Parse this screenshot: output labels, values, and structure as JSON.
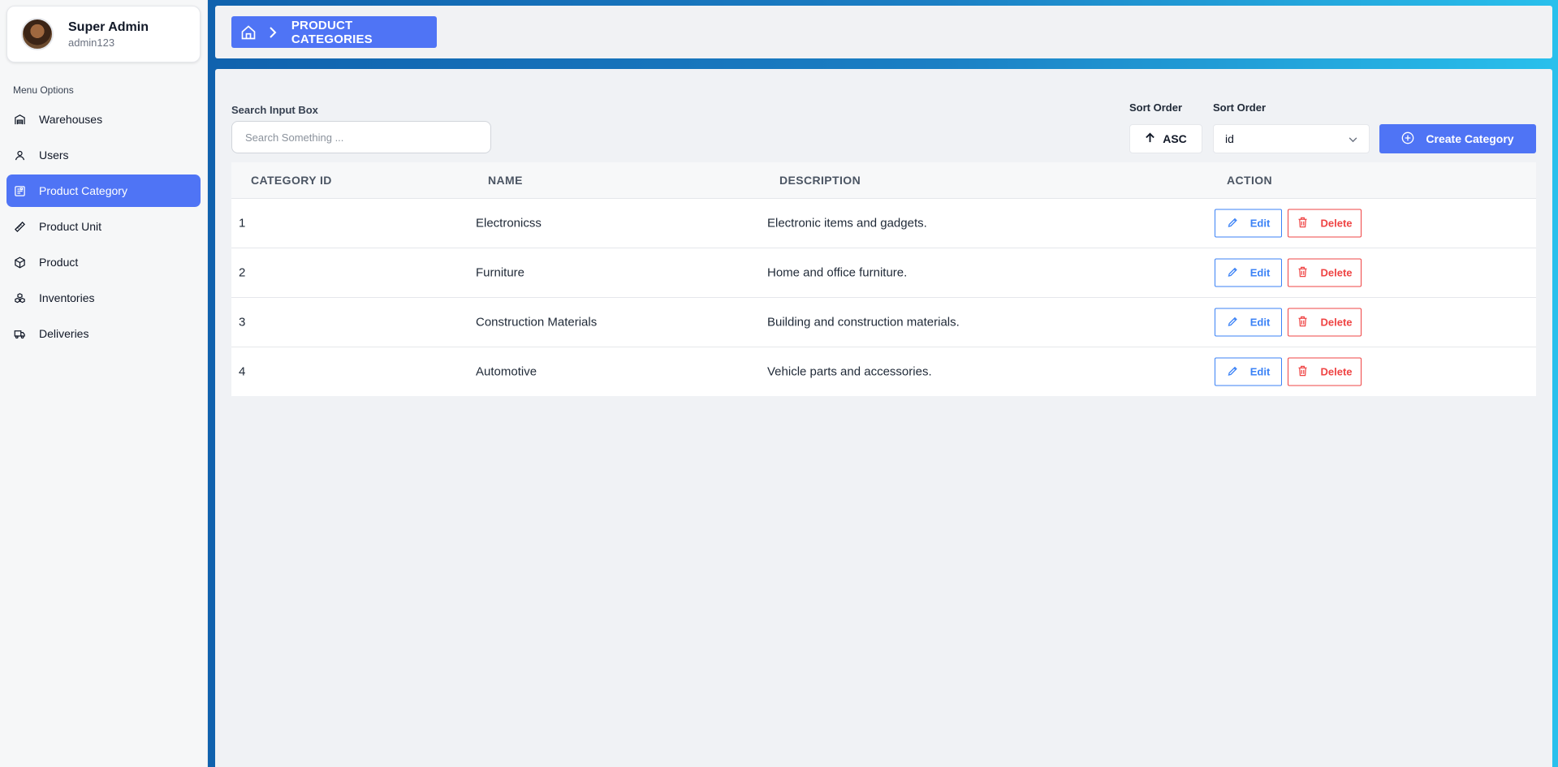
{
  "profile": {
    "name": "Super Admin",
    "username": "admin123"
  },
  "sidebar": {
    "menu_title": "Menu Options",
    "items": [
      {
        "label": "Warehouses",
        "icon": "warehouse-icon",
        "active": false
      },
      {
        "label": "Users",
        "icon": "user-icon",
        "active": false
      },
      {
        "label": "Product Category",
        "icon": "category-icon",
        "active": true
      },
      {
        "label": "Product Unit",
        "icon": "ruler-icon",
        "active": false
      },
      {
        "label": "Product",
        "icon": "box-icon",
        "active": false
      },
      {
        "label": "Inventories",
        "icon": "boxes-icon",
        "active": false
      },
      {
        "label": "Deliveries",
        "icon": "truck-icon",
        "active": false
      }
    ]
  },
  "header": {
    "breadcrumb_label": "PRODUCT CATEGORIES"
  },
  "toolbar": {
    "search_label": "Search Input Box",
    "search_placeholder": "Search Something ...",
    "sort_direction_label": "Sort Order",
    "sort_direction_value": "ASC",
    "sort_field_label": "Sort Order",
    "sort_field_value": "id",
    "create_label": "Create Category"
  },
  "table": {
    "headers": [
      "CATEGORY ID",
      "NAME",
      "DESCRIPTION",
      "ACTION"
    ],
    "rows": [
      {
        "id": "1",
        "name": "Electronicss",
        "description": "Electronic items and gadgets.",
        "edit": "Edit",
        "delete": "Delete"
      },
      {
        "id": "2",
        "name": "Furniture",
        "description": "Home and office furniture.",
        "edit": "Edit",
        "delete": "Delete"
      },
      {
        "id": "3",
        "name": "Construction Materials",
        "description": "Building and construction materials.",
        "edit": "Edit",
        "delete": "Delete"
      },
      {
        "id": "4",
        "name": "Automotive",
        "description": "Vehicle parts and accessories.",
        "edit": "Edit",
        "delete": "Delete"
      }
    ]
  },
  "colors": {
    "accent": "#4f74f5",
    "edit": "#3b82f6",
    "delete": "#ef4444"
  }
}
